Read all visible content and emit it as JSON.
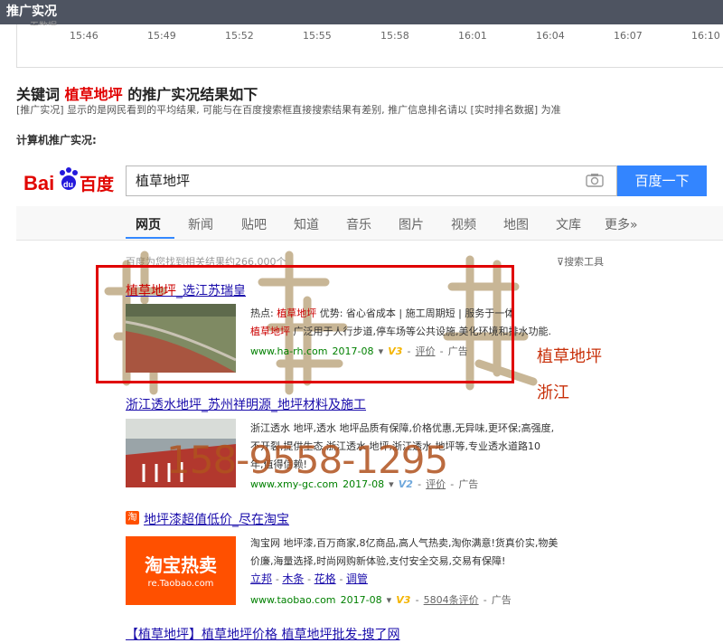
{
  "window": {
    "title": "推广实况"
  },
  "timeline": {
    "cut_label": "无数据",
    "ticks": [
      "15:46",
      "15:49",
      "15:52",
      "15:55",
      "15:58",
      "16:01",
      "16:04",
      "16:07",
      "16:10"
    ]
  },
  "header": {
    "prefix": "关键词",
    "keyword": "植草地坪",
    "suffix": "的推广实况结果如下",
    "note": "[推广实况] 显示的是网民看到的平均结果, 可能与在百度搜索框直接搜索结果有差别, 推广信息排名请以 [实时排名数据] 为准",
    "pc_label": "计算机推广实况:"
  },
  "baidu": {
    "logo_bai": "Bai",
    "logo_du": "du",
    "logo_text": "百度",
    "query": "植草地坪",
    "search_button": "百度一下",
    "nav": [
      "网页",
      "新闻",
      "贴吧",
      "知道",
      "音乐",
      "图片",
      "视频",
      "地图",
      "文库",
      "更多»"
    ],
    "result_count": "百度为您找到相关结果约266,000个",
    "tools": "搜索工具"
  },
  "results": [
    {
      "title_hl": "植草地坪",
      "title_rest": "_选江苏瑞皇",
      "line1_a": "热点: ",
      "line1_hl": "植草地坪",
      "line1_b": "    优势: 省心省成本 | 施工周期短 | 服务于一体",
      "line2_hl": "植草地坪",
      "line2_b": " 广泛用于人行步道,停车场等公共设施,美化环境和排水功能.",
      "url": "www.ha-rh.com",
      "date": "2017-08",
      "v": "V3",
      "review": "评价",
      "ad": "广告"
    },
    {
      "title": "浙江透水地坪_苏州祥明源_地坪材料及施工",
      "line1": "浙江透水 地坪,透水 地坪品质有保障,价格优惠,无异味,更环保;高强度,",
      "line2": "不开裂,提供生态 浙江透水 地坪,浙江透水 地坪等,专业透水道路10",
      "line3": "年,值得信赖!",
      "url": "www.xmy-gc.com",
      "date": "2017-08",
      "v": "V2",
      "review": "评价",
      "ad": "广告"
    },
    {
      "icon": "淘",
      "title": "地坪漆超值低价_尽在淘宝",
      "line1": "淘宝网 地坪漆,百万商家,8亿商品,高人气热卖,淘你满意!货真价实,物美",
      "line2": "价廉,海量选择,时尚网购新体验,支付安全交易,交易有保障!",
      "links": [
        "立邦",
        "木条",
        "花格",
        "调管"
      ],
      "url": "www.taobao.com",
      "date": "2017-08",
      "v": "V3",
      "review": "5804条评价",
      "ad": "广告",
      "thumb_big": "淘宝热卖",
      "thumb_small": "re.Taobao.com"
    }
  ],
  "last_line": "【植草地坪】植草地坪价格  植草地坪批发-搜了网",
  "overlay": {
    "annot1": "植草地坪",
    "annot2": "浙江",
    "phone": "158-9558-1295"
  }
}
